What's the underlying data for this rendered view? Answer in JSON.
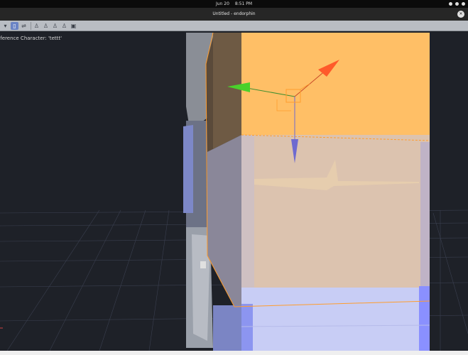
{
  "topbar": {
    "date": "Jun 20",
    "time": "8:51 PM"
  },
  "window": {
    "title": "Untitled - endorphin"
  },
  "toolbar": {
    "icons": [
      "selection-icon",
      "move-icon",
      "walk-icon",
      "walk-icon",
      "walk-icon",
      "walk-icon",
      "camera-icon"
    ]
  },
  "viewport": {
    "reference_label": "eference Character: 'tettt'"
  },
  "colors": {
    "background": "#1e2128",
    "selection": "#ffbf66",
    "body": "#c8cdf5",
    "accent_blue": "#8a90ff",
    "gizmo_red": "#ff5a2a",
    "gizmo_green": "#4ad12b",
    "gizmo_blue": "#6e6ad0"
  }
}
